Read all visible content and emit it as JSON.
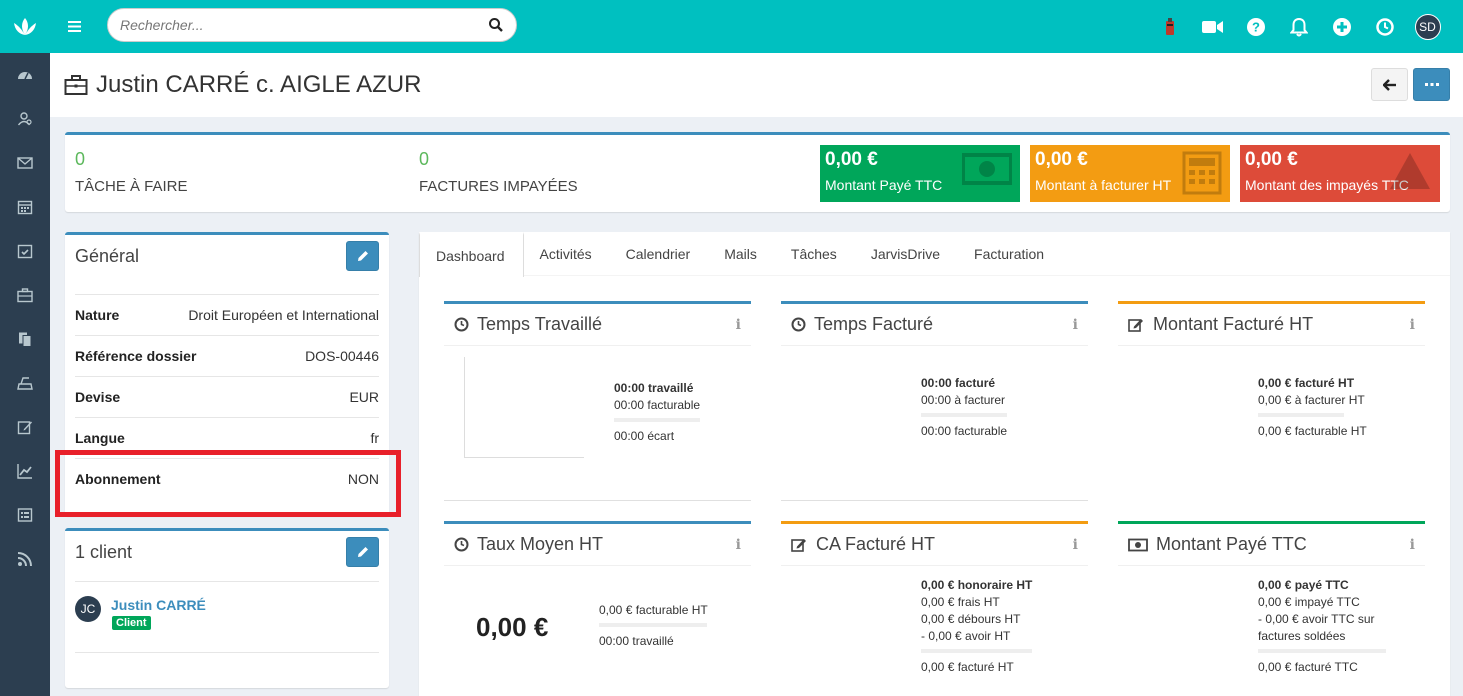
{
  "topbar": {
    "search_placeholder": "Rechercher...",
    "user_initials": "SD"
  },
  "colors": {
    "teal": "#00c0c0",
    "sidebar": "#2c3e50",
    "primary": "#3c8dbc",
    "green": "#00a65a",
    "orange": "#f39c12",
    "red": "#dd4b39"
  },
  "page": {
    "title": "Justin CARRÉ c. AIGLE AZUR"
  },
  "stats": {
    "tasks_count": "0",
    "tasks_label": "TÂCHE À FAIRE",
    "invoices_count": "0",
    "invoices_label": "FACTURES IMPAYÉES",
    "kpis": [
      {
        "value": "0,00 €",
        "label": "Montant Payé TTC"
      },
      {
        "value": "0,00 €",
        "label": "Montant à facturer HT"
      },
      {
        "value": "0,00 €",
        "label": "Montant des impayés TTC"
      }
    ]
  },
  "general": {
    "title": "Général",
    "rows": [
      {
        "key": "Nature",
        "value": "Droit Européen et International"
      },
      {
        "key": "Référence dossier",
        "value": "DOS-00446"
      },
      {
        "key": "Devise",
        "value": "EUR"
      },
      {
        "key": "Langue",
        "value": "fr"
      },
      {
        "key": "Abonnement",
        "value": "NON"
      }
    ]
  },
  "clients": {
    "title": "1 client",
    "items": [
      {
        "initials": "JC",
        "name": "Justin CARRÉ",
        "badge": "Client"
      }
    ]
  },
  "tabs": [
    "Dashboard",
    "Activités",
    "Calendrier",
    "Mails",
    "Tâches",
    "JarvisDrive",
    "Facturation"
  ],
  "cards": {
    "temps_travaille": {
      "title": "Temps Travaillé",
      "line1": "00:00 travaillé",
      "line2": "00:00 facturable",
      "line3": "00:00 écart"
    },
    "temps_facture": {
      "title": "Temps Facturé",
      "line1": "00:00 facturé",
      "line2": "00:00 à facturer",
      "line3": "00:00 facturable"
    },
    "montant_facture": {
      "title": "Montant Facturé HT",
      "line1": "0,00 € facturé HT",
      "line2": "0,00 € à facturer HT",
      "line3": "0,00 € facturable HT"
    },
    "taux_moyen": {
      "title": "Taux Moyen HT",
      "big": "0,00 €",
      "line1": "0,00 € facturable HT",
      "line2": "00:00 travaillé"
    },
    "ca_facture": {
      "title": "CA Facturé HT",
      "line1": "0,00 € honoraire HT",
      "line2": "0,00 € frais HT",
      "line3": "0,00 € débours HT",
      "line4": "- 0,00 € avoir HT",
      "line5": "0,00 € facturé HT"
    },
    "montant_paye": {
      "title": "Montant Payé TTC",
      "line1": "0,00 € payé TTC",
      "line2": "0,00 € impayé TTC",
      "line3": "- 0,00 € avoir TTC sur factures soldées",
      "line4": "0,00 € facturé TTC"
    }
  }
}
